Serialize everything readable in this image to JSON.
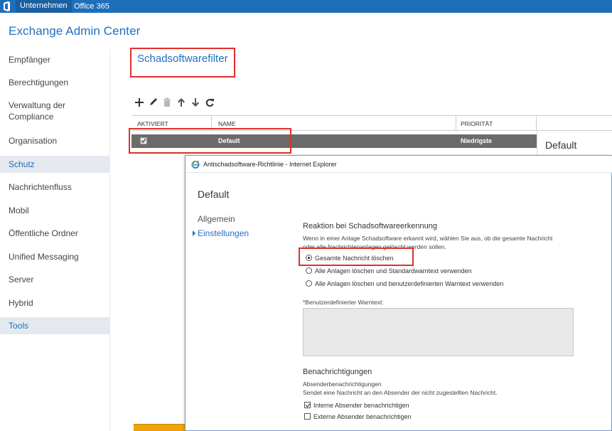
{
  "topbar": {
    "tabs": [
      "Unternehmen",
      "Office 365"
    ],
    "accent": "#1e6fb9"
  },
  "app": {
    "title": "Exchange Admin Center"
  },
  "sidebar": {
    "items": [
      {
        "label": "Empfänger"
      },
      {
        "label": "Berechtigungen"
      },
      {
        "label": "Verwaltung der Compliance"
      },
      {
        "label": "Organisation"
      },
      {
        "label": "Schutz",
        "selected": true
      },
      {
        "label": "Nachrichtenfluss"
      },
      {
        "label": "Mobil"
      },
      {
        "label": "Öffentliche Ordner"
      },
      {
        "label": "Unified Messaging"
      },
      {
        "label": "Server"
      },
      {
        "label": "Hybrid"
      },
      {
        "label": "Tools"
      }
    ]
  },
  "page": {
    "title": "Schadsoftwarefilter"
  },
  "toolbar": {
    "icons": [
      "add-icon",
      "edit-icon",
      "delete-icon",
      "arrow-up-icon",
      "arrow-down-icon",
      "refresh-icon"
    ]
  },
  "grid": {
    "columns": [
      "AKTIVIERT",
      "NAME",
      "PRIORITÄT"
    ],
    "rows": [
      {
        "enabled": true,
        "name": "Default",
        "priority": "Niedrigste"
      }
    ]
  },
  "details": {
    "title": "Default"
  },
  "dialog": {
    "window_title": "Antischadsoftware-Richtlinie - Internet Explorer",
    "heading": "Default",
    "nav": [
      "Allgemein",
      "Einstellungen"
    ],
    "response": {
      "title": "Reaktion bei Schadsoftwareerkennung",
      "description": "Wenn in einer Anlage Schadsoftware erkannt wird, wählen Sie aus, ob die gesamte Nachricht oder alle Nachrichtenanlagen gelöscht werden sollen.",
      "options": [
        {
          "label": "Gesamte Nachricht löschen",
          "selected": true
        },
        {
          "label": "Alle Anlagen löschen und Standardwarntext verwenden",
          "selected": false
        },
        {
          "label": "Alle Anlagen löschen und benutzerdefinierten Warntext verwenden",
          "selected": false
        }
      ],
      "custom_text_label": "*Benutzerdefinierter Warntext:",
      "custom_text_value": ""
    },
    "notifications": {
      "title": "Benachrichtigungen",
      "subtitle": "Absenderbenachrichtigungen",
      "description": "Sendet eine Nachricht an den Absender der nicht zugestellten Nachricht.",
      "checkboxes": [
        {
          "label": "Interne Absender benachrichtigen",
          "checked": true
        },
        {
          "label": "Externe Absender benachrichtigen",
          "checked": false
        }
      ]
    }
  },
  "colors": {
    "link": "#1f70c1",
    "highlight": "#e0302a",
    "selected_row": "#6b6b6b"
  }
}
